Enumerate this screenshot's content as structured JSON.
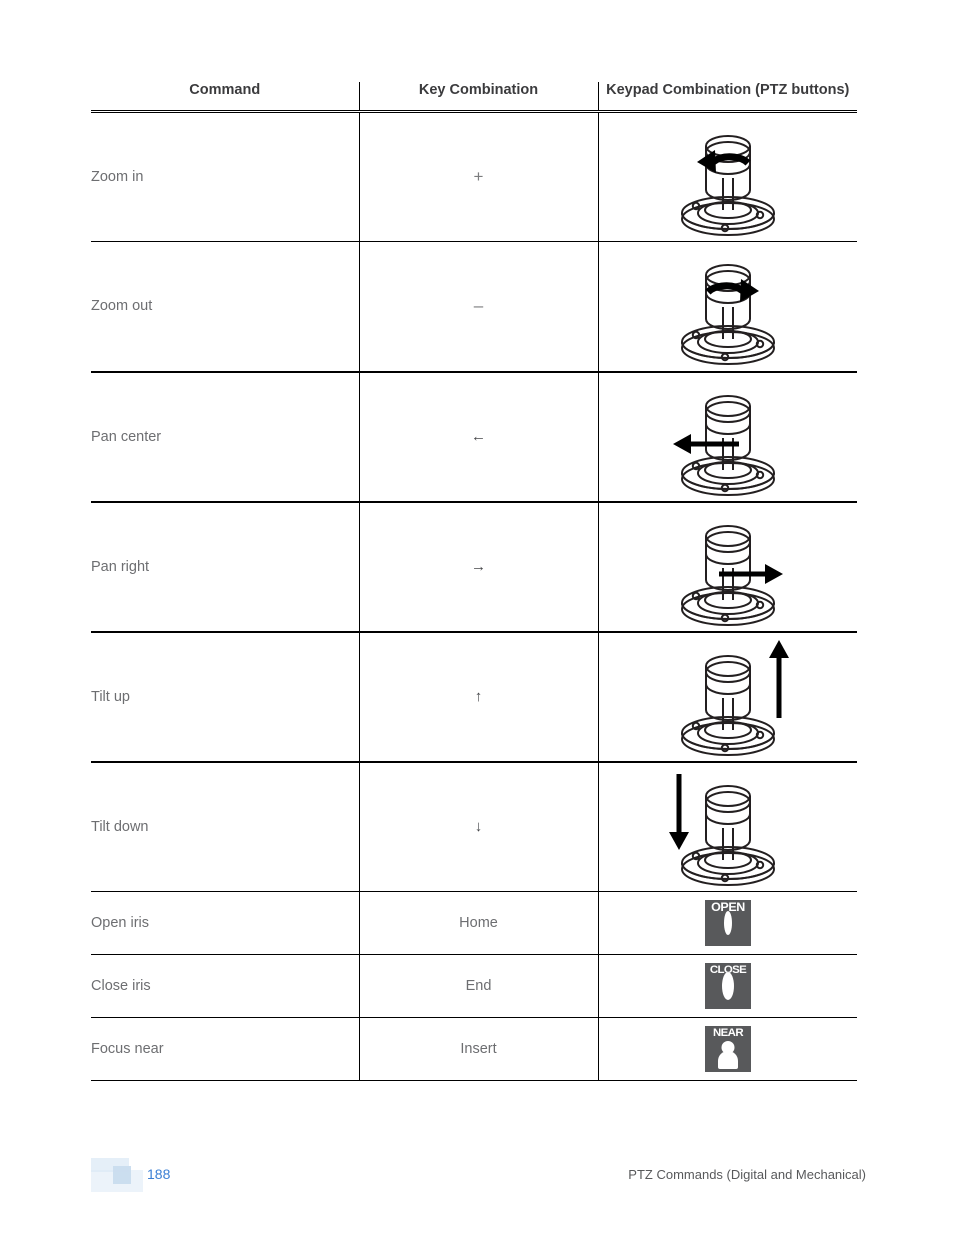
{
  "table": {
    "headers": [
      "Command",
      "Key Combination",
      "Keypad Combination (PTZ buttons)"
    ],
    "rows": [
      {
        "command": "Zoom in",
        "key": "+",
        "key_icon": "plus-sign",
        "keypad_icon": "joystick-rotate-left",
        "keypad_label": ""
      },
      {
        "command": "Zoom out",
        "key": "–",
        "key_icon": "minus-sign",
        "keypad_icon": "joystick-rotate-right",
        "keypad_label": ""
      },
      {
        "command": "Pan center",
        "key": "←",
        "key_icon": "arrow-left-icon",
        "keypad_icon": "joystick-move-left",
        "keypad_label": ""
      },
      {
        "command": "Pan right",
        "key": "→",
        "key_icon": "arrow-right-icon",
        "keypad_icon": "joystick-move-right",
        "keypad_label": ""
      },
      {
        "command": "Tilt up",
        "key": "↑",
        "key_icon": "arrow-up-icon",
        "keypad_icon": "joystick-move-up",
        "keypad_label": ""
      },
      {
        "command": "Tilt down",
        "key": "↓",
        "key_icon": "arrow-down-icon",
        "keypad_icon": "joystick-move-down",
        "keypad_label": ""
      },
      {
        "command": "Open iris",
        "key": "Home",
        "key_icon": "",
        "keypad_icon": "open-iris-button",
        "keypad_label": "OPEN"
      },
      {
        "command": "Close iris",
        "key": "End",
        "key_icon": "",
        "keypad_icon": "close-iris-button",
        "keypad_label": "CLOSE"
      },
      {
        "command": "Focus near",
        "key": "Insert",
        "key_icon": "",
        "keypad_icon": "focus-near-button",
        "keypad_label": "NEAR"
      }
    ]
  },
  "footer": {
    "page_number": "188",
    "note": "PTZ Commands (Digital and Mechanical)",
    "page_number_color": "#3b7fd4",
    "logo_color": "#dce9f5"
  }
}
